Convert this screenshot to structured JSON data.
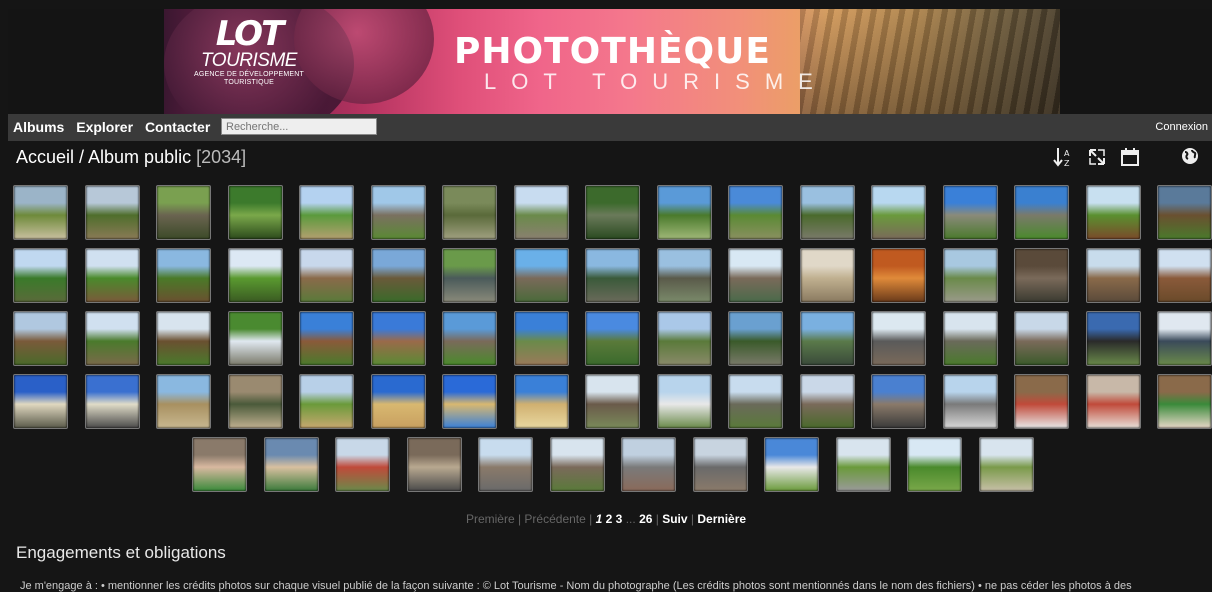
{
  "banner": {
    "logo_lot": "LOT",
    "logo_tourisme": "TOURISME",
    "logo_sub1": "AGENCE DE DÉVELOPPEMENT",
    "logo_sub2": "TOURISTIQUE",
    "title": "PHOTOTHÈQUE",
    "subtitle": "LOT TOURISME"
  },
  "menu": {
    "items": [
      "Albums",
      "Explorer",
      "Contacter"
    ],
    "search_placeholder": "Recherche...",
    "login": "Connexion"
  },
  "breadcrumb": {
    "text": "Accueil / Album public",
    "count": "[2034]"
  },
  "toolbar": {
    "icons": [
      "sort-az-icon",
      "slideshow-expand-icon",
      "calendar-icon",
      "globe-map-icon"
    ]
  },
  "thumbnails": [
    [
      "#9bb4c8",
      "#6e8a3a",
      "#c9c0a0"
    ],
    [
      "#b7c8d8",
      "#4f6e2c",
      "#8a7a56"
    ],
    [
      "#7aa050",
      "#6a6450",
      "#3c4a28"
    ],
    [
      "#3c7a2c",
      "#7aa84a",
      "#2c4a1c"
    ],
    [
      "#b4d2f0",
      "#5a9a3c",
      "#b4a070"
    ],
    [
      "#a0c8e8",
      "#7a7060",
      "#5a8a34"
    ],
    [
      "#7a8a5a",
      "#5a6a3a",
      "#a0a080"
    ],
    [
      "#c8dcf0",
      "#6a8a4a",
      "#8a8070"
    ],
    [
      "#3c6a2c",
      "#6a7a5a",
      "#2a4a20"
    ],
    [
      "#5a9ad8",
      "#4a7a2c",
      "#a0b878"
    ],
    [
      "#4a8ad8",
      "#5a8a34",
      "#8a9060"
    ],
    [
      "#9ac0e0",
      "#4a6a2c",
      "#7a7a6a"
    ],
    [
      "#b8d8f0",
      "#6a9a3c",
      "#7a6a5a"
    ],
    [
      "#3a80d8",
      "#8a8a7a",
      "#4a7a2c"
    ],
    [
      "#3a80d0",
      "#7a7a6a",
      "#4a8a2c"
    ],
    [
      "#c8e0f0",
      "#5a9030",
      "#7a4a2a"
    ],
    [
      "#5a7a9a",
      "#6a5030",
      "#4a7a2c"
    ],
    [
      "#c0d8f0",
      "#3a7a2a",
      "#5a6a3a"
    ],
    [
      "#d0e0f0",
      "#4a8a2c",
      "#7a5a3a"
    ],
    [
      "#8ab8e0",
      "#4a7a28",
      "#6a5030"
    ],
    [
      "#dce8f4",
      "#5a9a30",
      "#3a5a22"
    ],
    [
      "#c8d8ec",
      "#8a6a4a",
      "#5a7a3a"
    ],
    [
      "#7aa8d8",
      "#6a5a3a",
      "#3a6a2a"
    ],
    [
      "#6a9a4a",
      "#4a5a5a",
      "#8a8a7a"
    ],
    [
      "#6ab0e8",
      "#7a6a5a",
      "#4a6a3a"
    ],
    [
      "#8ab8e0",
      "#3a5a3a",
      "#6a6a5a"
    ],
    [
      "#9ac0e0",
      "#5a5a4a",
      "#7a8a6a"
    ],
    [
      "#d8e8f4",
      "#7a6a5a",
      "#4a6a4a"
    ],
    [
      "#e0d8c8",
      "#c0b090",
      "#8a7a60"
    ],
    [
      "#c05a20",
      "#e08a3a",
      "#6a3a1a"
    ],
    [
      "#a8c8e0",
      "#6a8a4a",
      "#9a9a8a"
    ],
    [
      "#5a4a3a",
      "#7a6a5a",
      "#3a3a30"
    ],
    [
      "#c8dcec",
      "#8a6a4a",
      "#5a4a3a"
    ],
    [
      "#d0e0f0",
      "#8a5a3a",
      "#6a4a2a"
    ],
    [
      "#b0c8e0",
      "#7a5a3a",
      "#4a6a2a"
    ],
    [
      "#d0e0f0",
      "#4a7a2c",
      "#7a6a4a"
    ],
    [
      "#d8e4ee",
      "#6a5030",
      "#4a7a2c"
    ],
    [
      "#4a8a30",
      "#e0e8f0",
      "#7a7a6a"
    ],
    [
      "#3a80d8",
      "#8a5a3a",
      "#4a7a2c"
    ],
    [
      "#3a7ad8",
      "#9a6a4a",
      "#5a8a34"
    ],
    [
      "#5a9ad8",
      "#7a6a5a",
      "#4a8a2c"
    ],
    [
      "#3a80d8",
      "#6a8a4a",
      "#9a7a5a"
    ],
    [
      "#4a8ae0",
      "#5a7a3a",
      "#3a6a2c"
    ],
    [
      "#aac8e8",
      "#5a7a3a",
      "#8a8a6a"
    ],
    [
      "#6aa0d0",
      "#3a5a2a",
      "#7a7a6a"
    ],
    [
      "#7ab0e0",
      "#5a7a4a",
      "#3a4a3a"
    ],
    [
      "#dce8f0",
      "#5a5a5a",
      "#7a6a5a"
    ],
    [
      "#d8e4ee",
      "#6a6a5a",
      "#4a7a2c"
    ],
    [
      "#c8d8e8",
      "#7a6a5a",
      "#3a5a2a"
    ],
    [
      "#3a6ab0",
      "#2a2a2a",
      "#6a8a4a"
    ],
    [
      "#e0e8f0",
      "#3a4a5a",
      "#6a8a4a"
    ],
    [
      "#2a60c8",
      "#e0d8c0",
      "#5a5a4a"
    ],
    [
      "#3a70d0",
      "#e0dcc8",
      "#4a4a4a"
    ],
    [
      "#8ab8e0",
      "#a89060",
      "#c8b890"
    ],
    [
      "#9a8a70",
      "#4a5a3a",
      "#c0b090"
    ],
    [
      "#b8d0e8",
      "#6a9a3a",
      "#c8a870"
    ],
    [
      "#2a6ad0",
      "#d8b870",
      "#c8a060"
    ],
    [
      "#2a6ad8",
      "#d8b870",
      "#3a80d8"
    ],
    [
      "#3a80d8",
      "#d0b070",
      "#e8d8a0"
    ],
    [
      "#d8e4ee",
      "#6a5a4a",
      "#7a8a5a"
    ],
    [
      "#b8d4ec",
      "#e8e8e8",
      "#6a8a4a"
    ],
    [
      "#c8dcee",
      "#6a6a5a",
      "#5a7a3a"
    ],
    [
      "#cad8e8",
      "#7a6a5a",
      "#4a6a2c"
    ],
    [
      "#4a80d0",
      "#8a7a6a",
      "#3a3a3a"
    ],
    [
      "#b8d4ec",
      "#7a7a7a",
      "#d8d8d8"
    ],
    [
      "#8a6a4a",
      "#c04a3a",
      "#e8e8e8"
    ],
    [
      "#c8b8a8",
      "#c04a3a",
      "#e8e0d8"
    ],
    [
      "#8a6a4a",
      "#3a8a3a",
      "#e8d8c8"
    ],
    [
      "#8a7a6a",
      "#d8b8a0",
      "#3a8a3a"
    ],
    [
      "#6a8ab0",
      "#d8c0a0",
      "#3a7a3a"
    ],
    [
      "#c8d8e8",
      "#c04a3a",
      "#6a8a4a"
    ],
    [
      "#7a6a5a",
      "#b8a890",
      "#4a4a4a"
    ],
    [
      "#c8dcee",
      "#8a7a6a",
      "#6a6a6a"
    ],
    [
      "#d8e4ee",
      "#7a6a5a",
      "#5a7a3a"
    ],
    [
      "#c0d0e0",
      "#7a7a7a",
      "#8a6a5a"
    ],
    [
      "#c8d4e0",
      "#6a6a6a",
      "#8a7a6a"
    ],
    [
      "#4a88d8",
      "#e8e8e8",
      "#6a9a3a"
    ],
    [
      "#d8e4ee",
      "#6a9a3a",
      "#9a9a9a"
    ],
    [
      "#d8e8f4",
      "#4a8a2c",
      "#7aa84a"
    ],
    [
      "#d8e4ee",
      "#7a9a4a",
      "#c8c0a8"
    ]
  ],
  "pagination": {
    "first": "Première",
    "prev": "Précédente",
    "current": "1",
    "pages": [
      "2",
      "3"
    ],
    "ellipsis": "...",
    "last_page": "26",
    "next": "Suiv",
    "last": "Dernière"
  },
  "engagements": {
    "title": "Engagements et obligations",
    "text": "Je m'engage à : • mentionner les crédits photos sur chaque visuel publié de la façon suivante : © Lot Tourisme - Nom du photographe (Les crédits photos sont mentionnés dans le nom des fichiers) • ne pas céder les photos à des"
  }
}
